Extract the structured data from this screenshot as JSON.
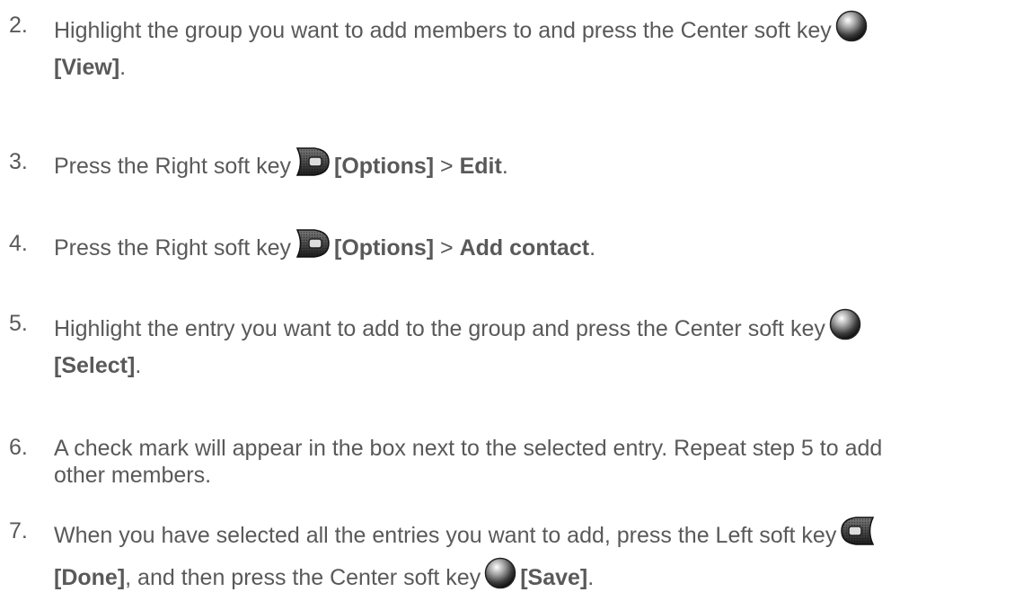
{
  "steps": [
    {
      "num": "2.",
      "a": "Highlight the group you want to add members to and press the Center soft key",
      "b1": "[View]",
      "b1_after": "."
    },
    {
      "num": "3.",
      "a": "Press the Right soft key",
      "b1": "[Options]",
      "mid": " > ",
      "b2": "Edit",
      "end": "."
    },
    {
      "num": "4.",
      "a": "Press the Right soft key",
      "b1": "[Options]",
      "mid": " > ",
      "b2": "Add contact",
      "end": "."
    },
    {
      "num": "5.",
      "a": "Highlight the entry you want to add to the group and press the Center soft key",
      "b1": "[Select]",
      "b1_after": "."
    },
    {
      "num": "6.",
      "l1": "A check mark will appear in the box next to the selected entry. Repeat step 5 to add",
      "l2": "other members."
    },
    {
      "num": "7.",
      "a": "When you have selected all the entries you want to add, press the Left soft key",
      "b1": "[Done]",
      "mid": ", and then press the Center soft key",
      "b2": "[Save]",
      "end": "."
    }
  ],
  "icons": {
    "center": "center-soft-key-icon",
    "right": "right-soft-key-icon",
    "left": "left-soft-key-icon"
  }
}
